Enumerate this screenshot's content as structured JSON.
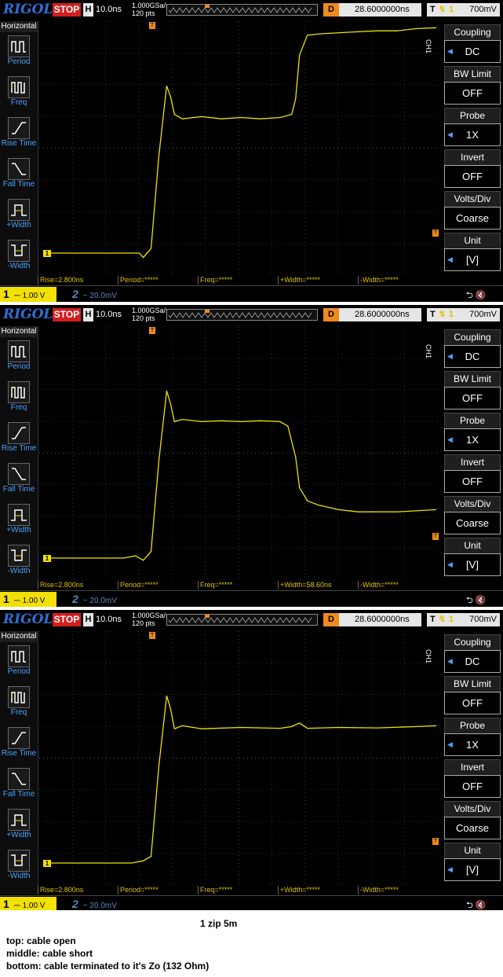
{
  "scope": {
    "logo": "RIGOL",
    "run_state": "STOP",
    "h_label": "H",
    "timebase": "10.0ns",
    "sample_rate": "1.000GSa/s",
    "points": "120  pts",
    "delay_label": "D",
    "delay": "28.6000000ns",
    "trig_label": "T",
    "trig_level": "700mV",
    "horizontal_title": "Horizontal",
    "left_items": [
      "Period",
      "Freq",
      "Rise Time",
      "Fall Time",
      "+Width",
      "-Width"
    ],
    "right_items": [
      {
        "head": "Coupling",
        "value": "DC"
      },
      {
        "head": "BW Limit",
        "value": "OFF"
      },
      {
        "head": "Probe",
        "value": "1X"
      },
      {
        "head": "Invert",
        "value": "OFF"
      },
      {
        "head": "Volts/Div",
        "value": "Coarse"
      },
      {
        "head": "Unit",
        "value": "[V]"
      }
    ],
    "channel_label": "CH1",
    "ch1_num": "1",
    "ch1_scale": "1.00 V",
    "ch2_num": "2",
    "ch2_scale": "20.0mV",
    "colors": {
      "trace": "#f2e100",
      "accent": "#4aa3ff",
      "stop": "#d31e1e",
      "trigger": "#f08a1c"
    }
  },
  "screens": [
    {
      "name": "open",
      "measurements": [
        "Rise=2.800ns",
        "Period=*****",
        "Freq=*****",
        "+Width=*****",
        "-Width=*****"
      ],
      "waveform_points": [
        [
          0,
          0.0
        ],
        [
          0.24,
          0.0
        ],
        [
          0.25,
          -0.1
        ],
        [
          0.27,
          0.1
        ],
        [
          0.29,
          2.2
        ],
        [
          0.31,
          3.8
        ],
        [
          0.32,
          3.55
        ],
        [
          0.33,
          3.15
        ],
        [
          0.35,
          3.05
        ],
        [
          0.4,
          3.1
        ],
        [
          0.45,
          3.05
        ],
        [
          0.5,
          3.08
        ],
        [
          0.55,
          3.05
        ],
        [
          0.6,
          3.08
        ],
        [
          0.63,
          3.15
        ],
        [
          0.64,
          3.5
        ],
        [
          0.65,
          4.5
        ],
        [
          0.67,
          4.95
        ],
        [
          0.7,
          4.98
        ],
        [
          0.78,
          5.02
        ],
        [
          0.85,
          5.05
        ],
        [
          0.9,
          5.05
        ],
        [
          0.95,
          5.1
        ],
        [
          1.0,
          5.12
        ]
      ]
    },
    {
      "name": "short",
      "measurements": [
        "Rise=2.800ns",
        "Period=*****",
        "Freq=*****",
        "+Width=58.60ns",
        "-Width=*****"
      ],
      "waveform_points": [
        [
          0,
          0.0
        ],
        [
          0.2,
          0.0
        ],
        [
          0.23,
          0.05
        ],
        [
          0.25,
          -0.05
        ],
        [
          0.27,
          0.15
        ],
        [
          0.29,
          2.2
        ],
        [
          0.31,
          3.8
        ],
        [
          0.32,
          3.5
        ],
        [
          0.33,
          3.1
        ],
        [
          0.35,
          3.15
        ],
        [
          0.4,
          3.1
        ],
        [
          0.45,
          3.12
        ],
        [
          0.5,
          3.1
        ],
        [
          0.55,
          3.12
        ],
        [
          0.6,
          3.1
        ],
        [
          0.62,
          3.0
        ],
        [
          0.64,
          2.3
        ],
        [
          0.65,
          1.6
        ],
        [
          0.67,
          1.3
        ],
        [
          0.7,
          1.2
        ],
        [
          0.75,
          1.1
        ],
        [
          0.8,
          1.05
        ],
        [
          0.9,
          1.05
        ],
        [
          1.0,
          1.1
        ]
      ]
    },
    {
      "name": "terminated",
      "measurements": [
        "Rise=2.800ns",
        "Period=*****",
        "Freq=*****",
        "+Width=*****",
        "-Width=*****"
      ],
      "waveform_points": [
        [
          0,
          0.0
        ],
        [
          0.22,
          0.0
        ],
        [
          0.25,
          0.05
        ],
        [
          0.27,
          0.15
        ],
        [
          0.29,
          2.2
        ],
        [
          0.31,
          3.8
        ],
        [
          0.32,
          3.5
        ],
        [
          0.33,
          3.05
        ],
        [
          0.35,
          3.12
        ],
        [
          0.4,
          3.05
        ],
        [
          0.5,
          3.08
        ],
        [
          0.6,
          3.06
        ],
        [
          0.63,
          3.1
        ],
        [
          0.65,
          3.18
        ],
        [
          0.67,
          3.06
        ],
        [
          0.75,
          3.08
        ],
        [
          0.85,
          3.07
        ],
        [
          0.95,
          3.1
        ],
        [
          1.0,
          3.12
        ]
      ]
    }
  ],
  "caption": {
    "title": "1 zip 5m",
    "lines": [
      "top: cable open",
      "middle: cable short",
      "bottom: cable terminated to it's Zo (132 Ohm)"
    ]
  }
}
